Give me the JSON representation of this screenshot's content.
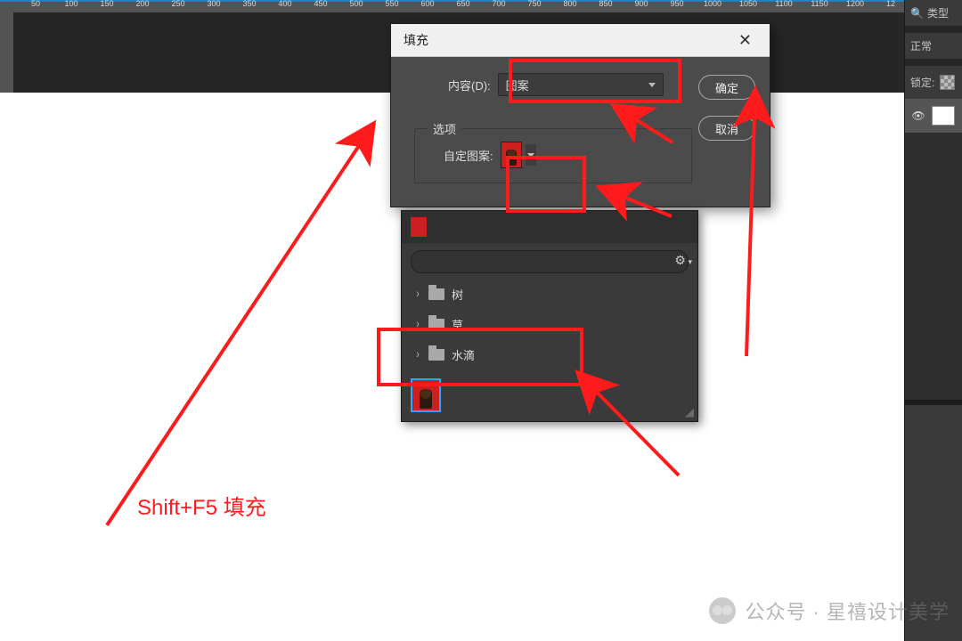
{
  "ruler_ticks": [
    "50",
    "100",
    "150",
    "200",
    "250",
    "300",
    "350",
    "400",
    "450",
    "500",
    "550",
    "600",
    "650",
    "700",
    "750",
    "800",
    "850",
    "900",
    "950",
    "1000",
    "1050",
    "1100",
    "1150",
    "1200",
    "12"
  ],
  "dialog": {
    "title": "填充",
    "content_label": "内容(D):",
    "content_value": "图案",
    "ok": "确定",
    "cancel": "取消",
    "options_legend": "选项",
    "custom_pattern_label": "自定图案:"
  },
  "pattern_picker": {
    "folders": [
      "树",
      "草",
      "水滴"
    ]
  },
  "right_panel": {
    "search_label": "类型",
    "normal_label": "正常",
    "lock_label": "锁定:"
  },
  "annotation": {
    "text": "Shift+F5 填充"
  },
  "watermark": {
    "text": "公众号 · 星禧设计美学"
  }
}
